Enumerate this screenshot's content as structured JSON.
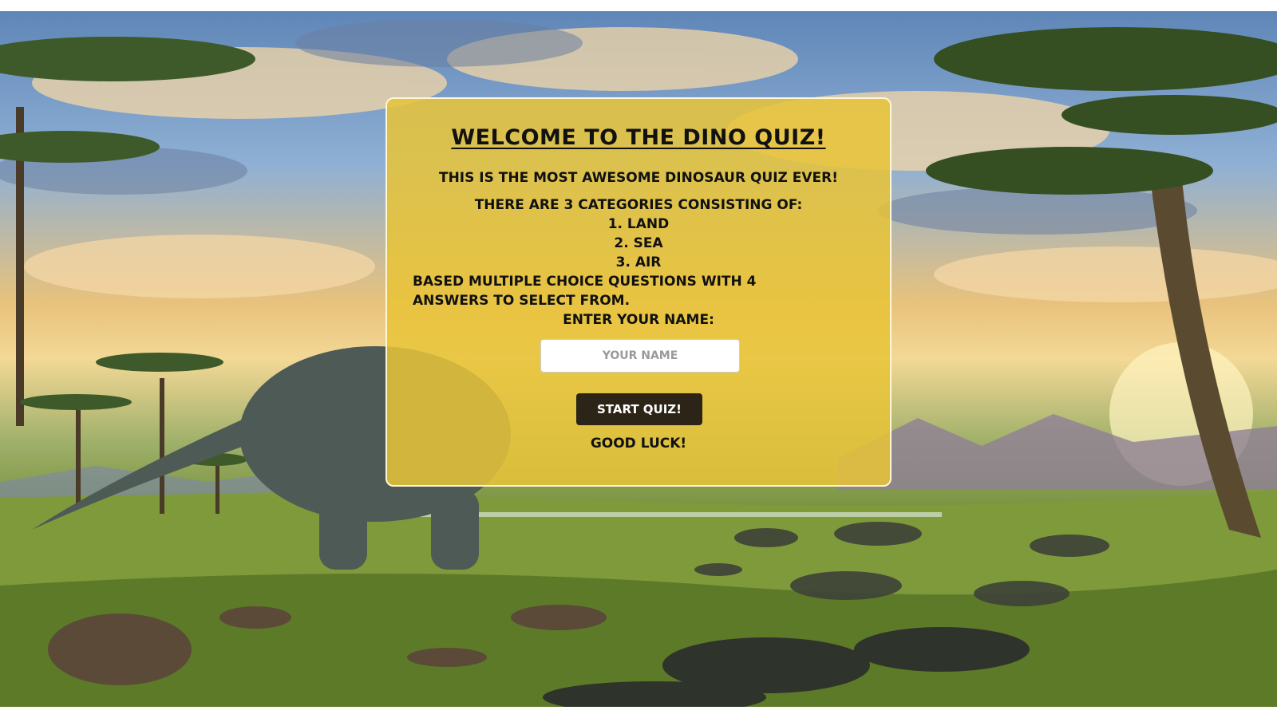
{
  "quiz": {
    "title": "Welcome to the Dino Quiz!",
    "intro": "This is the most awesome dinosaur quiz ever!",
    "categories_intro": "There are 3 categories consisting of:",
    "categories": [
      "1. Land",
      "2. Sea",
      "3. Air"
    ],
    "description": "Based multiple choice questions with 4 answers to select from.",
    "name_label": "Enter your name:",
    "name_placeholder": "Your Name",
    "name_value": "",
    "start_button": "Start Quiz!",
    "outro": "Good Luck!"
  },
  "theme": {
    "panel_color": "#e8c438",
    "button_color": "#2c2517",
    "text_color": "#111111"
  }
}
